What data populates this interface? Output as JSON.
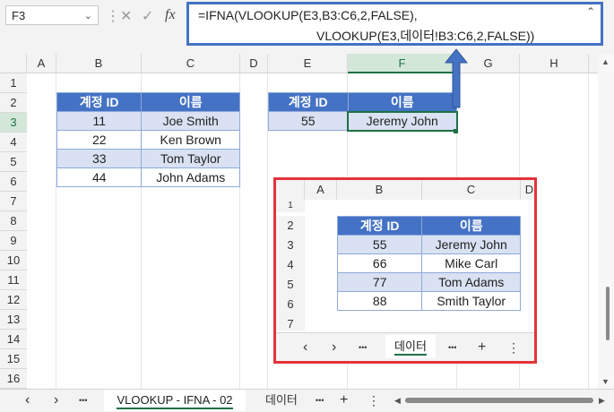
{
  "name_box": {
    "value": "F3"
  },
  "formula_bar": {
    "cancel_icon": "✕",
    "enter_icon": "✓",
    "fx_label": "fx",
    "line1": "=IFNA(VLOOKUP(E3,B3:C6,2,FALSE),",
    "line2": "VLOOKUP(E3,데이터!B3:C6,2,FALSE))"
  },
  "columns": [
    "A",
    "B",
    "C",
    "D",
    "E",
    "F",
    "G",
    "H"
  ],
  "rows": [
    "1",
    "2",
    "3",
    "4",
    "5",
    "6",
    "7",
    "8",
    "9",
    "10",
    "11",
    "12",
    "13",
    "14",
    "15",
    "16"
  ],
  "main_table": {
    "headers": [
      "계정 ID",
      "이름"
    ],
    "rows": [
      [
        "11",
        "Joe Smith"
      ],
      [
        "22",
        "Ken Brown"
      ],
      [
        "33",
        "Tom Taylor"
      ],
      [
        "44",
        "John Adams"
      ]
    ]
  },
  "lookup_table": {
    "headers": [
      "계정 ID",
      "이름"
    ],
    "row": [
      "55",
      "Jeremy John"
    ]
  },
  "inset": {
    "columns": [
      "A",
      "B",
      "C",
      "D"
    ],
    "rows": [
      "1",
      "2",
      "3",
      "4",
      "5",
      "6",
      "7"
    ],
    "table": {
      "headers": [
        "계정 ID",
        "이름"
      ],
      "rows": [
        [
          "55",
          "Jeremy John"
        ],
        [
          "66",
          "Mike Carl"
        ],
        [
          "77",
          "Tom Adams"
        ],
        [
          "88",
          "Smith Taylor"
        ]
      ]
    },
    "tabs": {
      "prev": "‹",
      "next": "›",
      "more": "•••",
      "active": "데이터",
      "more2": "•••",
      "add": "+",
      "menu": "⋮"
    }
  },
  "sheet_tabs": {
    "prev": "‹",
    "next": "›",
    "more": "•••",
    "active": "VLOOKUP - IFNA - 02",
    "other": "데이터",
    "more2": "•••",
    "add": "+",
    "menu": "⋮"
  },
  "colors": {
    "header_blue": "#4472c4",
    "band_blue": "#d9e1f2",
    "highlight_red": "#e3343a",
    "select_green": "#1e7145"
  }
}
